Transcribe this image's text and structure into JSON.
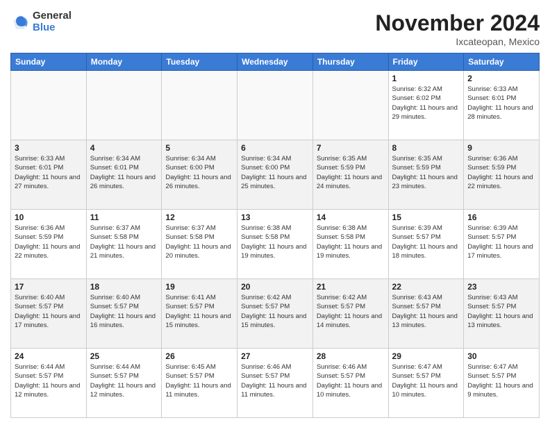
{
  "logo": {
    "general": "General",
    "blue": "Blue"
  },
  "header": {
    "month": "November 2024",
    "location": "Ixcateopan, Mexico"
  },
  "weekdays": [
    "Sunday",
    "Monday",
    "Tuesday",
    "Wednesday",
    "Thursday",
    "Friday",
    "Saturday"
  ],
  "weeks": [
    [
      {
        "day": "",
        "info": ""
      },
      {
        "day": "",
        "info": ""
      },
      {
        "day": "",
        "info": ""
      },
      {
        "day": "",
        "info": ""
      },
      {
        "day": "",
        "info": ""
      },
      {
        "day": "1",
        "info": "Sunrise: 6:32 AM\nSunset: 6:02 PM\nDaylight: 11 hours and 29 minutes."
      },
      {
        "day": "2",
        "info": "Sunrise: 6:33 AM\nSunset: 6:01 PM\nDaylight: 11 hours and 28 minutes."
      }
    ],
    [
      {
        "day": "3",
        "info": "Sunrise: 6:33 AM\nSunset: 6:01 PM\nDaylight: 11 hours and 27 minutes."
      },
      {
        "day": "4",
        "info": "Sunrise: 6:34 AM\nSunset: 6:01 PM\nDaylight: 11 hours and 26 minutes."
      },
      {
        "day": "5",
        "info": "Sunrise: 6:34 AM\nSunset: 6:00 PM\nDaylight: 11 hours and 26 minutes."
      },
      {
        "day": "6",
        "info": "Sunrise: 6:34 AM\nSunset: 6:00 PM\nDaylight: 11 hours and 25 minutes."
      },
      {
        "day": "7",
        "info": "Sunrise: 6:35 AM\nSunset: 5:59 PM\nDaylight: 11 hours and 24 minutes."
      },
      {
        "day": "8",
        "info": "Sunrise: 6:35 AM\nSunset: 5:59 PM\nDaylight: 11 hours and 23 minutes."
      },
      {
        "day": "9",
        "info": "Sunrise: 6:36 AM\nSunset: 5:59 PM\nDaylight: 11 hours and 22 minutes."
      }
    ],
    [
      {
        "day": "10",
        "info": "Sunrise: 6:36 AM\nSunset: 5:59 PM\nDaylight: 11 hours and 22 minutes."
      },
      {
        "day": "11",
        "info": "Sunrise: 6:37 AM\nSunset: 5:58 PM\nDaylight: 11 hours and 21 minutes."
      },
      {
        "day": "12",
        "info": "Sunrise: 6:37 AM\nSunset: 5:58 PM\nDaylight: 11 hours and 20 minutes."
      },
      {
        "day": "13",
        "info": "Sunrise: 6:38 AM\nSunset: 5:58 PM\nDaylight: 11 hours and 19 minutes."
      },
      {
        "day": "14",
        "info": "Sunrise: 6:38 AM\nSunset: 5:58 PM\nDaylight: 11 hours and 19 minutes."
      },
      {
        "day": "15",
        "info": "Sunrise: 6:39 AM\nSunset: 5:57 PM\nDaylight: 11 hours and 18 minutes."
      },
      {
        "day": "16",
        "info": "Sunrise: 6:39 AM\nSunset: 5:57 PM\nDaylight: 11 hours and 17 minutes."
      }
    ],
    [
      {
        "day": "17",
        "info": "Sunrise: 6:40 AM\nSunset: 5:57 PM\nDaylight: 11 hours and 17 minutes."
      },
      {
        "day": "18",
        "info": "Sunrise: 6:40 AM\nSunset: 5:57 PM\nDaylight: 11 hours and 16 minutes."
      },
      {
        "day": "19",
        "info": "Sunrise: 6:41 AM\nSunset: 5:57 PM\nDaylight: 11 hours and 15 minutes."
      },
      {
        "day": "20",
        "info": "Sunrise: 6:42 AM\nSunset: 5:57 PM\nDaylight: 11 hours and 15 minutes."
      },
      {
        "day": "21",
        "info": "Sunrise: 6:42 AM\nSunset: 5:57 PM\nDaylight: 11 hours and 14 minutes."
      },
      {
        "day": "22",
        "info": "Sunrise: 6:43 AM\nSunset: 5:57 PM\nDaylight: 11 hours and 13 minutes."
      },
      {
        "day": "23",
        "info": "Sunrise: 6:43 AM\nSunset: 5:57 PM\nDaylight: 11 hours and 13 minutes."
      }
    ],
    [
      {
        "day": "24",
        "info": "Sunrise: 6:44 AM\nSunset: 5:57 PM\nDaylight: 11 hours and 12 minutes."
      },
      {
        "day": "25",
        "info": "Sunrise: 6:44 AM\nSunset: 5:57 PM\nDaylight: 11 hours and 12 minutes."
      },
      {
        "day": "26",
        "info": "Sunrise: 6:45 AM\nSunset: 5:57 PM\nDaylight: 11 hours and 11 minutes."
      },
      {
        "day": "27",
        "info": "Sunrise: 6:46 AM\nSunset: 5:57 PM\nDaylight: 11 hours and 11 minutes."
      },
      {
        "day": "28",
        "info": "Sunrise: 6:46 AM\nSunset: 5:57 PM\nDaylight: 11 hours and 10 minutes."
      },
      {
        "day": "29",
        "info": "Sunrise: 6:47 AM\nSunset: 5:57 PM\nDaylight: 11 hours and 10 minutes."
      },
      {
        "day": "30",
        "info": "Sunrise: 6:47 AM\nSunset: 5:57 PM\nDaylight: 11 hours and 9 minutes."
      }
    ]
  ]
}
